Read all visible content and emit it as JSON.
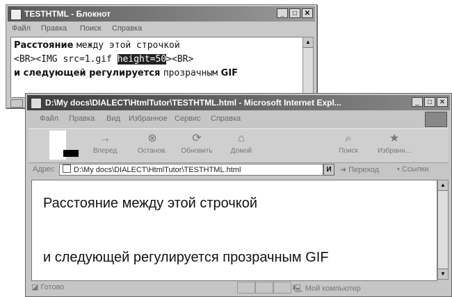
{
  "notepad": {
    "title": "TESTHTML - Блокнот",
    "menu": [
      "Файл",
      "Правка",
      "Поиск",
      "Справка"
    ],
    "lines": [
      {
        "pre": "Расстояние ",
        "mid": "между этой ст",
        "post": "рочкой"
      },
      {
        "pre": "<BR><IMG src=1.gif ",
        "sel": "height=50",
        "post": "><BR>"
      },
      {
        "text": "и следующей регулируется ",
        "mono": "прозрачным",
        "tail": " GIF"
      }
    ]
  },
  "ie": {
    "title_path": "D:\\My docs\\DIALECT\\HtmlTutor\\TESTHTML.html - ",
    "title_app": "Microsoft Internet Expl...",
    "menu": [
      "Файл",
      "Правка",
      "Вид",
      "Избранное",
      "Сервис",
      "Справка"
    ],
    "toolbar": [
      {
        "label": "Вперед",
        "icon": "→"
      },
      {
        "label": "Останов.",
        "icon": "⊗"
      },
      {
        "label": "Обновить",
        "icon": "⟳"
      },
      {
        "label": "Домой",
        "icon": "⌂"
      },
      {
        "label": "Поиск",
        "icon": "⌕"
      },
      {
        "label": "Избранн...",
        "icon": "★"
      }
    ],
    "address_label": "Адрес",
    "address_value": "D:\\My docs\\DIALECT\\HtmlTutor\\TESTHTML.html",
    "address_drop": "И",
    "go_label": "Переход",
    "links_label": "• Ссылки",
    "content": {
      "line1": "Расстояние между этой строчкой",
      "line2": "и следующей регулируется прозрачным GIF"
    },
    "status_left": "Готово",
    "status_zone": "Мой компьютер"
  }
}
